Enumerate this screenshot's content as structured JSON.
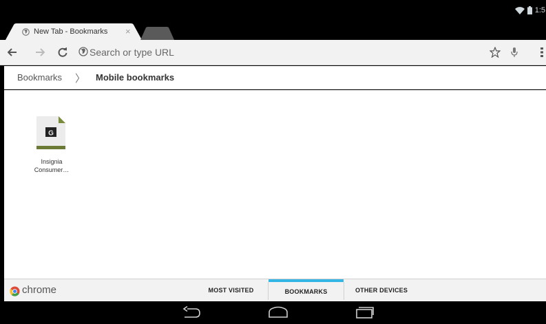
{
  "status_bar": {
    "time": "1:5"
  },
  "tab": {
    "title": "New Tab - Bookmarks",
    "close_glyph": "×"
  },
  "toolbar": {
    "back_icon": "back-arrow-icon",
    "forward_icon": "forward-arrow-icon",
    "reload_icon": "reload-icon",
    "omnibox_placeholder": "Search or type URL"
  },
  "breadcrumb": {
    "root": "Bookmarks",
    "separator": "〉",
    "current": "Mobile bookmarks"
  },
  "bookmarks": [
    {
      "title": "Insignia Consumer…",
      "favicon_letter": "G"
    }
  ],
  "bottom_bar": {
    "brand": "chrome",
    "tabs": [
      {
        "label": "MOST VISITED",
        "selected": false
      },
      {
        "label": "BOOKMARKS",
        "selected": true
      },
      {
        "label": "OTHER DEVICES",
        "selected": false
      }
    ]
  },
  "colors": {
    "accent": "#33b5e5",
    "toolbar": "#f2f2f2",
    "favicon_stripe": "#7a8c3c"
  }
}
